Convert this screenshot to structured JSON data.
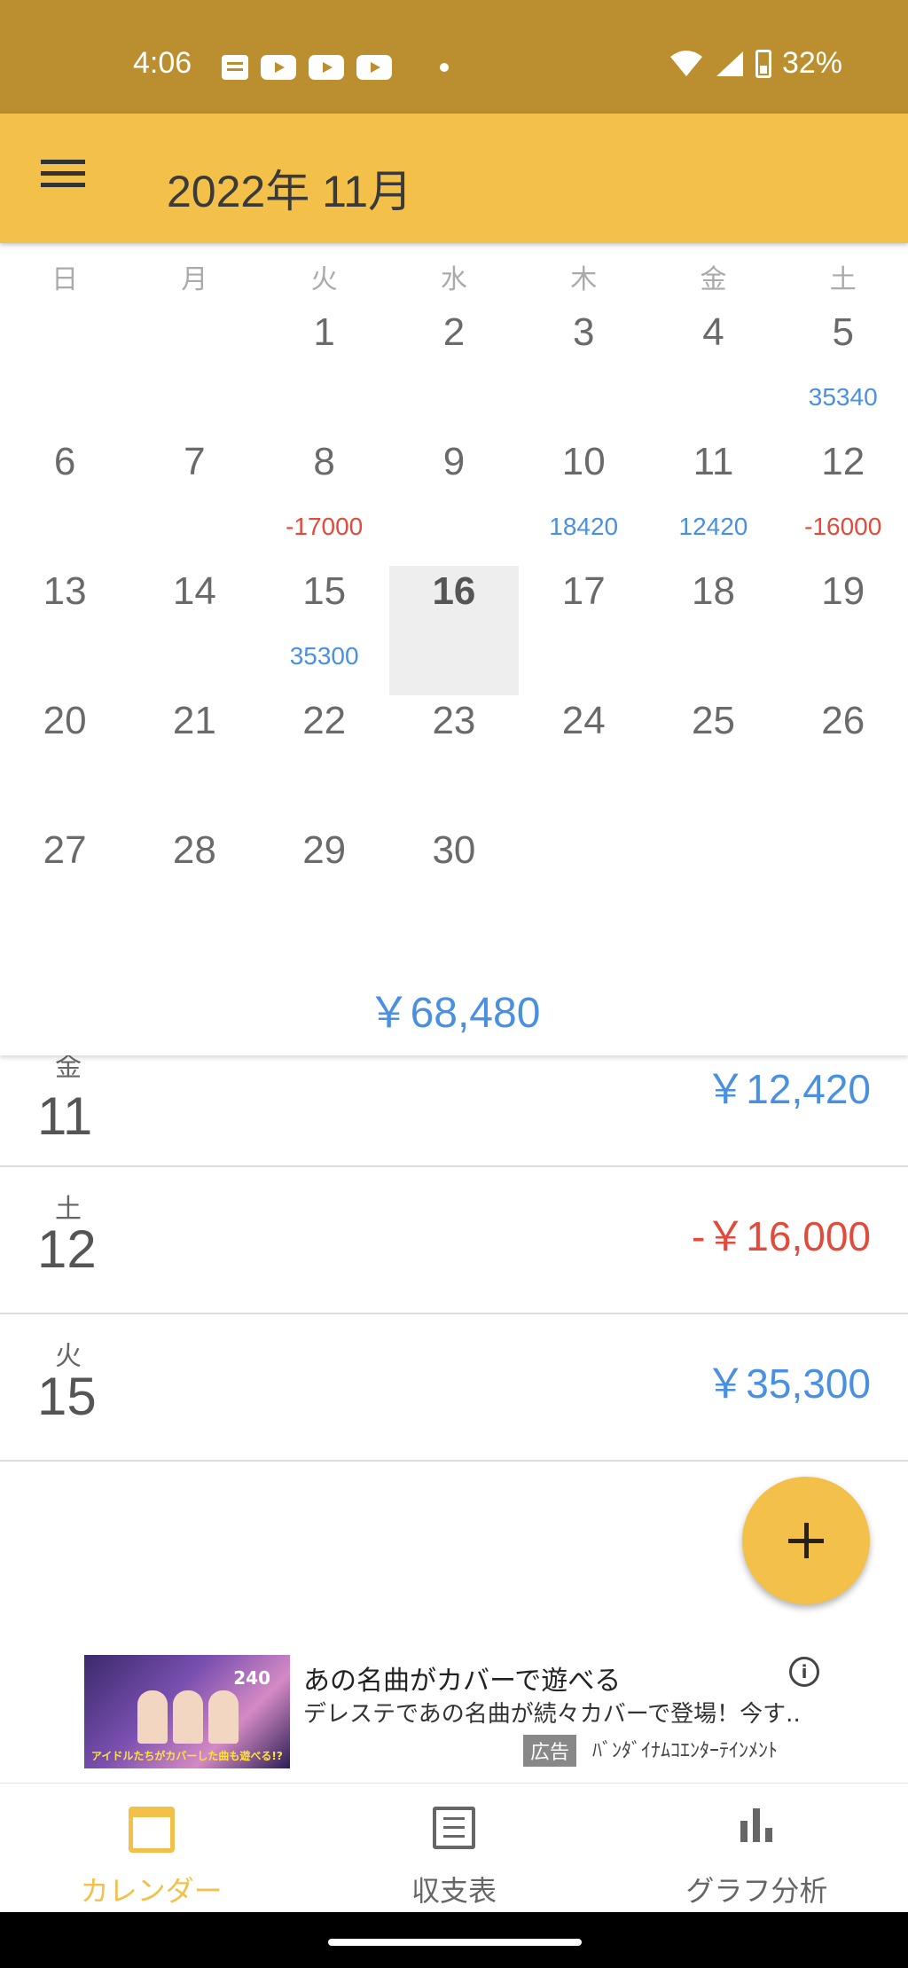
{
  "status_bar": {
    "time": "4:06",
    "battery": "32%"
  },
  "app_bar": {
    "title": "2022年 11月"
  },
  "calendar": {
    "weekdays": [
      "日",
      "月",
      "火",
      "水",
      "木",
      "金",
      "土"
    ],
    "today": "16",
    "days": [
      {
        "day": "",
        "amount": ""
      },
      {
        "day": "",
        "amount": ""
      },
      {
        "day": "1",
        "amount": ""
      },
      {
        "day": "2",
        "amount": ""
      },
      {
        "day": "3",
        "amount": ""
      },
      {
        "day": "4",
        "amount": ""
      },
      {
        "day": "5",
        "amount": "35340"
      },
      {
        "day": "6",
        "amount": ""
      },
      {
        "day": "7",
        "amount": ""
      },
      {
        "day": "8",
        "amount": "-17000"
      },
      {
        "day": "9",
        "amount": ""
      },
      {
        "day": "10",
        "amount": "18420"
      },
      {
        "day": "11",
        "amount": "12420"
      },
      {
        "day": "12",
        "amount": "-16000"
      },
      {
        "day": "13",
        "amount": ""
      },
      {
        "day": "14",
        "amount": ""
      },
      {
        "day": "15",
        "amount": "35300"
      },
      {
        "day": "16",
        "amount": ""
      },
      {
        "day": "17",
        "amount": ""
      },
      {
        "day": "18",
        "amount": ""
      },
      {
        "day": "19",
        "amount": ""
      },
      {
        "day": "20",
        "amount": ""
      },
      {
        "day": "21",
        "amount": ""
      },
      {
        "day": "22",
        "amount": ""
      },
      {
        "day": "23",
        "amount": ""
      },
      {
        "day": "24",
        "amount": ""
      },
      {
        "day": "25",
        "amount": ""
      },
      {
        "day": "26",
        "amount": ""
      },
      {
        "day": "27",
        "amount": ""
      },
      {
        "day": "28",
        "amount": ""
      },
      {
        "day": "29",
        "amount": ""
      },
      {
        "day": "30",
        "amount": ""
      }
    ],
    "month_total": "￥68,480"
  },
  "transactions": [
    {
      "weekday": "金",
      "day": "11",
      "amount": "￥12,420",
      "type": "income"
    },
    {
      "weekday": "土",
      "day": "12",
      "amount": "-￥16,000",
      "type": "expense"
    },
    {
      "weekday": "火",
      "day": "15",
      "amount": "￥35,300",
      "type": "income"
    }
  ],
  "ad": {
    "title": "あの名曲がカバーで遊べる",
    "body": "デレステであの名曲が続々カバーで登場！今す...",
    "label": "広告",
    "advertiser": "ﾊﾞﾝﾀﾞｲﾅﾑｺｴﾝﾀｰﾃｲﾝﾒﾝﾄ",
    "image_badge": "240",
    "image_caption": "アイドルたちがカバーした曲も遊べる!?"
  },
  "bottom_nav": {
    "items": [
      {
        "label": "カレンダー",
        "icon": "calendar-icon",
        "active": true
      },
      {
        "label": "収支表",
        "icon": "list-icon",
        "active": false
      },
      {
        "label": "グラフ分析",
        "icon": "bar-chart-icon",
        "active": false
      }
    ]
  },
  "colors": {
    "status_bar": "#bb8e2f",
    "accent": "#f3c04a",
    "income": "#4a90e2",
    "expense": "#e24a3b",
    "today_bg": "#eeeeee"
  }
}
